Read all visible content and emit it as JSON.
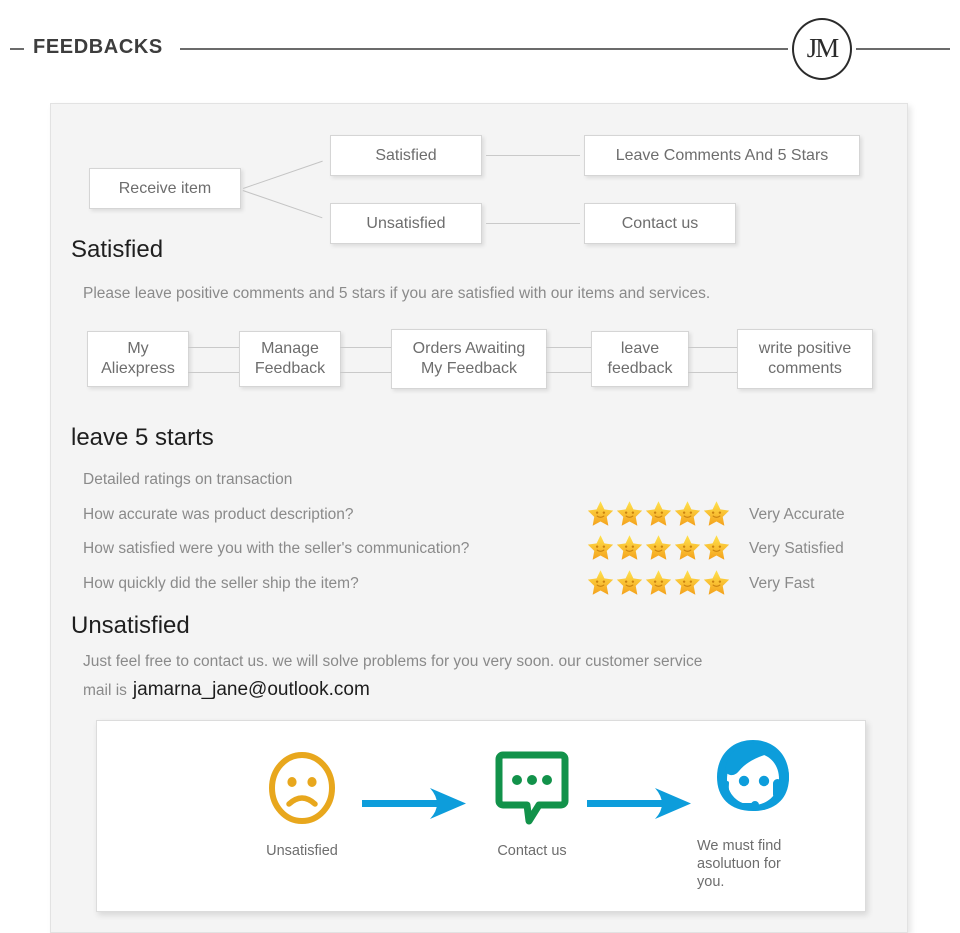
{
  "header": {
    "title": "FEEDBACKS",
    "logo_text": "JM",
    "logo_name": "jm-monogram-logo"
  },
  "flowchart": {
    "start": "Receive item",
    "branches": [
      {
        "condition": "Satisfied",
        "action": "Leave Comments And 5 Stars"
      },
      {
        "condition": "Unsatisfied",
        "action": "Contact us"
      }
    ]
  },
  "satisfied": {
    "heading": "Satisfied",
    "paragraph": "Please leave positive comments and 5 stars if you are satisfied with our items and services.",
    "steps": [
      "My\nAliexpress",
      "Manage\nFeedback",
      "Orders Awaiting\nMy Feedback",
      "leave\nfeedback",
      "write positive\ncomments"
    ],
    "step_labels": [
      {
        "line1": "My",
        "line2": "Aliexpress"
      },
      {
        "line1": "Manage",
        "line2": "Feedback"
      },
      {
        "line1": "Orders Awaiting",
        "line2": "My Feedback"
      },
      {
        "line1": "leave",
        "line2": "feedback"
      },
      {
        "line1": "write positive",
        "line2": "comments"
      }
    ]
  },
  "ratings": {
    "heading": "leave 5 starts",
    "subtitle": "Detailed ratings on transaction",
    "rows": [
      {
        "question": "How accurate was product description?",
        "stars": 5,
        "label": "Very Accurate"
      },
      {
        "question": "How satisfied were you with the seller's communication?",
        "stars": 5,
        "label": "Very Satisfied"
      },
      {
        "question": "How quickly did the seller ship the item?",
        "stars": 5,
        "label": "Very Fast"
      }
    ],
    "star_color_light": "#ffd23d",
    "star_color_dark": "#f5a623"
  },
  "unsatisfied": {
    "heading": "Unsatisfied",
    "paragraph": "Just feel free to contact us. we will solve problems for you very soon. our customer service",
    "mail_prefix": "mail is",
    "email": "jamarna_jane@outlook.com"
  },
  "illustration": {
    "steps": [
      {
        "icon": "sad-face-icon",
        "caption": "Unsatisfied"
      },
      {
        "icon": "speech-bubble-icon",
        "caption": "Contact us"
      },
      {
        "icon": "support-agent-icon",
        "caption_line1": "We must find",
        "caption_line2": "asolutuon for",
        "caption_line3": "you."
      }
    ],
    "colors": {
      "sad_face": "#e8a71d",
      "arrow": "#0d9ddb",
      "bubble": "#12924a",
      "agent": "#0d9ddb"
    }
  }
}
